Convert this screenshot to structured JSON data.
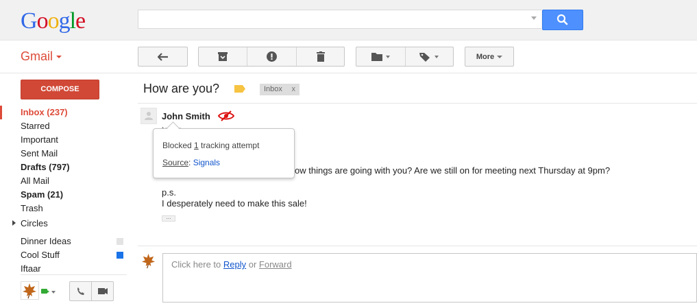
{
  "logo": {
    "letters": [
      "G",
      "o",
      "o",
      "g",
      "l",
      "e"
    ],
    "colors": [
      "#3369e8",
      "#d50f25",
      "#eeb211",
      "#3369e8",
      "#009925",
      "#d50f25"
    ]
  },
  "search": {
    "value": "",
    "placeholder": ""
  },
  "app": {
    "name": "Gmail"
  },
  "toolbar": {
    "more_label": "More"
  },
  "compose_label": "COMPOSE",
  "sidebar": {
    "items": [
      {
        "label": "Inbox (237)"
      },
      {
        "label": "Starred"
      },
      {
        "label": "Important"
      },
      {
        "label": "Sent Mail"
      },
      {
        "label": "Drafts (797)"
      },
      {
        "label": "All Mail"
      },
      {
        "label": "Spam (21)"
      },
      {
        "label": "Trash"
      },
      {
        "label": "Circles"
      }
    ],
    "labels": [
      {
        "label": "Dinner Ideas",
        "color": "#e3e3e3"
      },
      {
        "label": "Cool Stuff",
        "color": "#1a73e8"
      },
      {
        "label": "Iftaar"
      }
    ]
  },
  "thread": {
    "subject": "How are you?",
    "label_chip": "Inbox",
    "chip_close": "x"
  },
  "message": {
    "sender": "John Smith",
    "to": "to me",
    "body_visible": "ow things are going with you? Are we still on for meeting next Thursday at 9pm?",
    "ps": "p.s.",
    "ps_line": "I desperately need to make this sale!",
    "dots": "..."
  },
  "popup": {
    "blocked_prefix": "Blocked ",
    "blocked_count": "1",
    "blocked_suffix": " tracking attempt",
    "source_label": "Source",
    "source_sep": ": ",
    "source_value": "Signals"
  },
  "reply": {
    "prefix": "Click here to ",
    "reply_link": "Reply",
    "or": " or ",
    "forward_link": "Forward"
  },
  "colors": {
    "accent_red": "#dd4b39",
    "search_blue": "#4d90fe",
    "tracker_red": "#dd1111"
  }
}
